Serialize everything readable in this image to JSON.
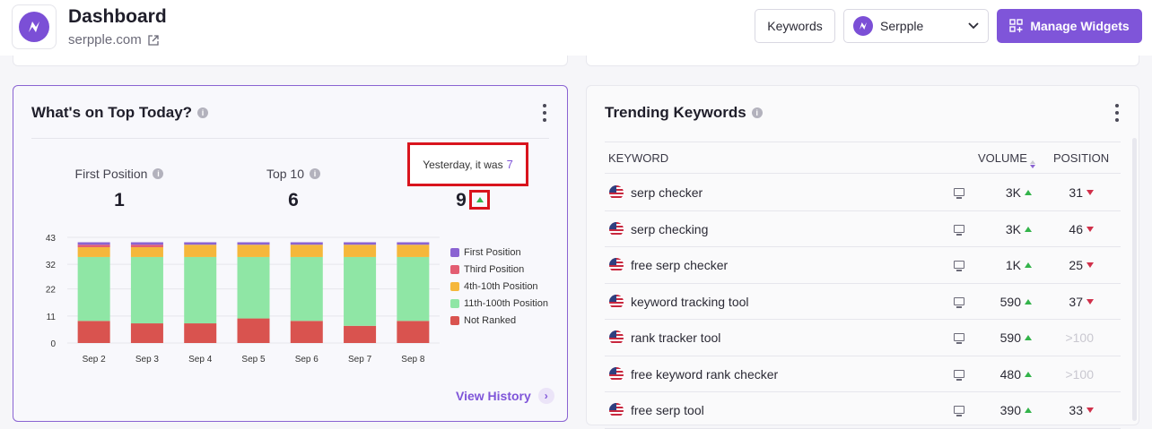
{
  "header": {
    "title": "Dashboard",
    "domain": "serpple.com",
    "keywords_button": "Keywords",
    "project_select": "Serpple",
    "manage_button": "Manage Widgets"
  },
  "top_today": {
    "title": "What's on Top Today?",
    "stats": [
      {
        "label": "First Position",
        "value": "1"
      },
      {
        "label": "Top 10",
        "value": "6"
      },
      {
        "value": "9"
      }
    ],
    "tooltip_text": "Yesterday, it was",
    "tooltip_value": "7",
    "view_history": "View History"
  },
  "chart_data": {
    "type": "bar",
    "stacked": true,
    "categories": [
      "Sep 2",
      "Sep 3",
      "Sep 4",
      "Sep 5",
      "Sep 6",
      "Sep 7",
      "Sep 8"
    ],
    "y_ticks": [
      "43",
      "32",
      "22",
      "11",
      "0"
    ],
    "ylim": [
      0,
      43
    ],
    "grid": true,
    "legend_position": "right",
    "series": [
      {
        "name": "Not Ranked",
        "color": "#d9534f",
        "values": [
          9,
          8,
          8,
          10,
          9,
          7,
          9
        ]
      },
      {
        "name": "11th-100th Position",
        "color": "#8fe6a5",
        "values": [
          26,
          27,
          27,
          25,
          26,
          28,
          26
        ]
      },
      {
        "name": "4th-10th Position",
        "color": "#f5b73b",
        "values": [
          4,
          4,
          5,
          5,
          5,
          5,
          5
        ]
      },
      {
        "name": "Third Position",
        "color": "#e35d72",
        "values": [
          1,
          1,
          0,
          0,
          0,
          0,
          0
        ]
      },
      {
        "name": "First Position",
        "color": "#8a63d2",
        "values": [
          1,
          1,
          1,
          1,
          1,
          1,
          1
        ]
      }
    ],
    "legend_order": [
      "First Position",
      "Third Position",
      "4th-10th Position",
      "11th-100th Position",
      "Not Ranked"
    ]
  },
  "trending": {
    "title": "Trending Keywords",
    "columns": {
      "keyword": "KEYWORD",
      "volume": "VOLUME",
      "position": "POSITION"
    },
    "rows": [
      {
        "keyword": "serp checker",
        "volume": "3K",
        "position": "31",
        "pos_trend": "down"
      },
      {
        "keyword": "serp checking",
        "volume": "3K",
        "position": "46",
        "pos_trend": "down"
      },
      {
        "keyword": "free serp checker",
        "volume": "1K",
        "position": "25",
        "pos_trend": "down"
      },
      {
        "keyword": "keyword tracking tool",
        "volume": "590",
        "position": "37",
        "pos_trend": "down"
      },
      {
        "keyword": "rank tracker tool",
        "volume": "590",
        "position": ">100",
        "pos_trend": "none"
      },
      {
        "keyword": "free keyword rank checker",
        "volume": "480",
        "position": ">100",
        "pos_trend": "none"
      },
      {
        "keyword": "free serp tool",
        "volume": "390",
        "position": "33",
        "pos_trend": "down"
      }
    ]
  },
  "colors": {
    "accent": "#7f55d9",
    "highlight": "#d9141d",
    "up": "#33b34a",
    "down": "#d0304a"
  }
}
